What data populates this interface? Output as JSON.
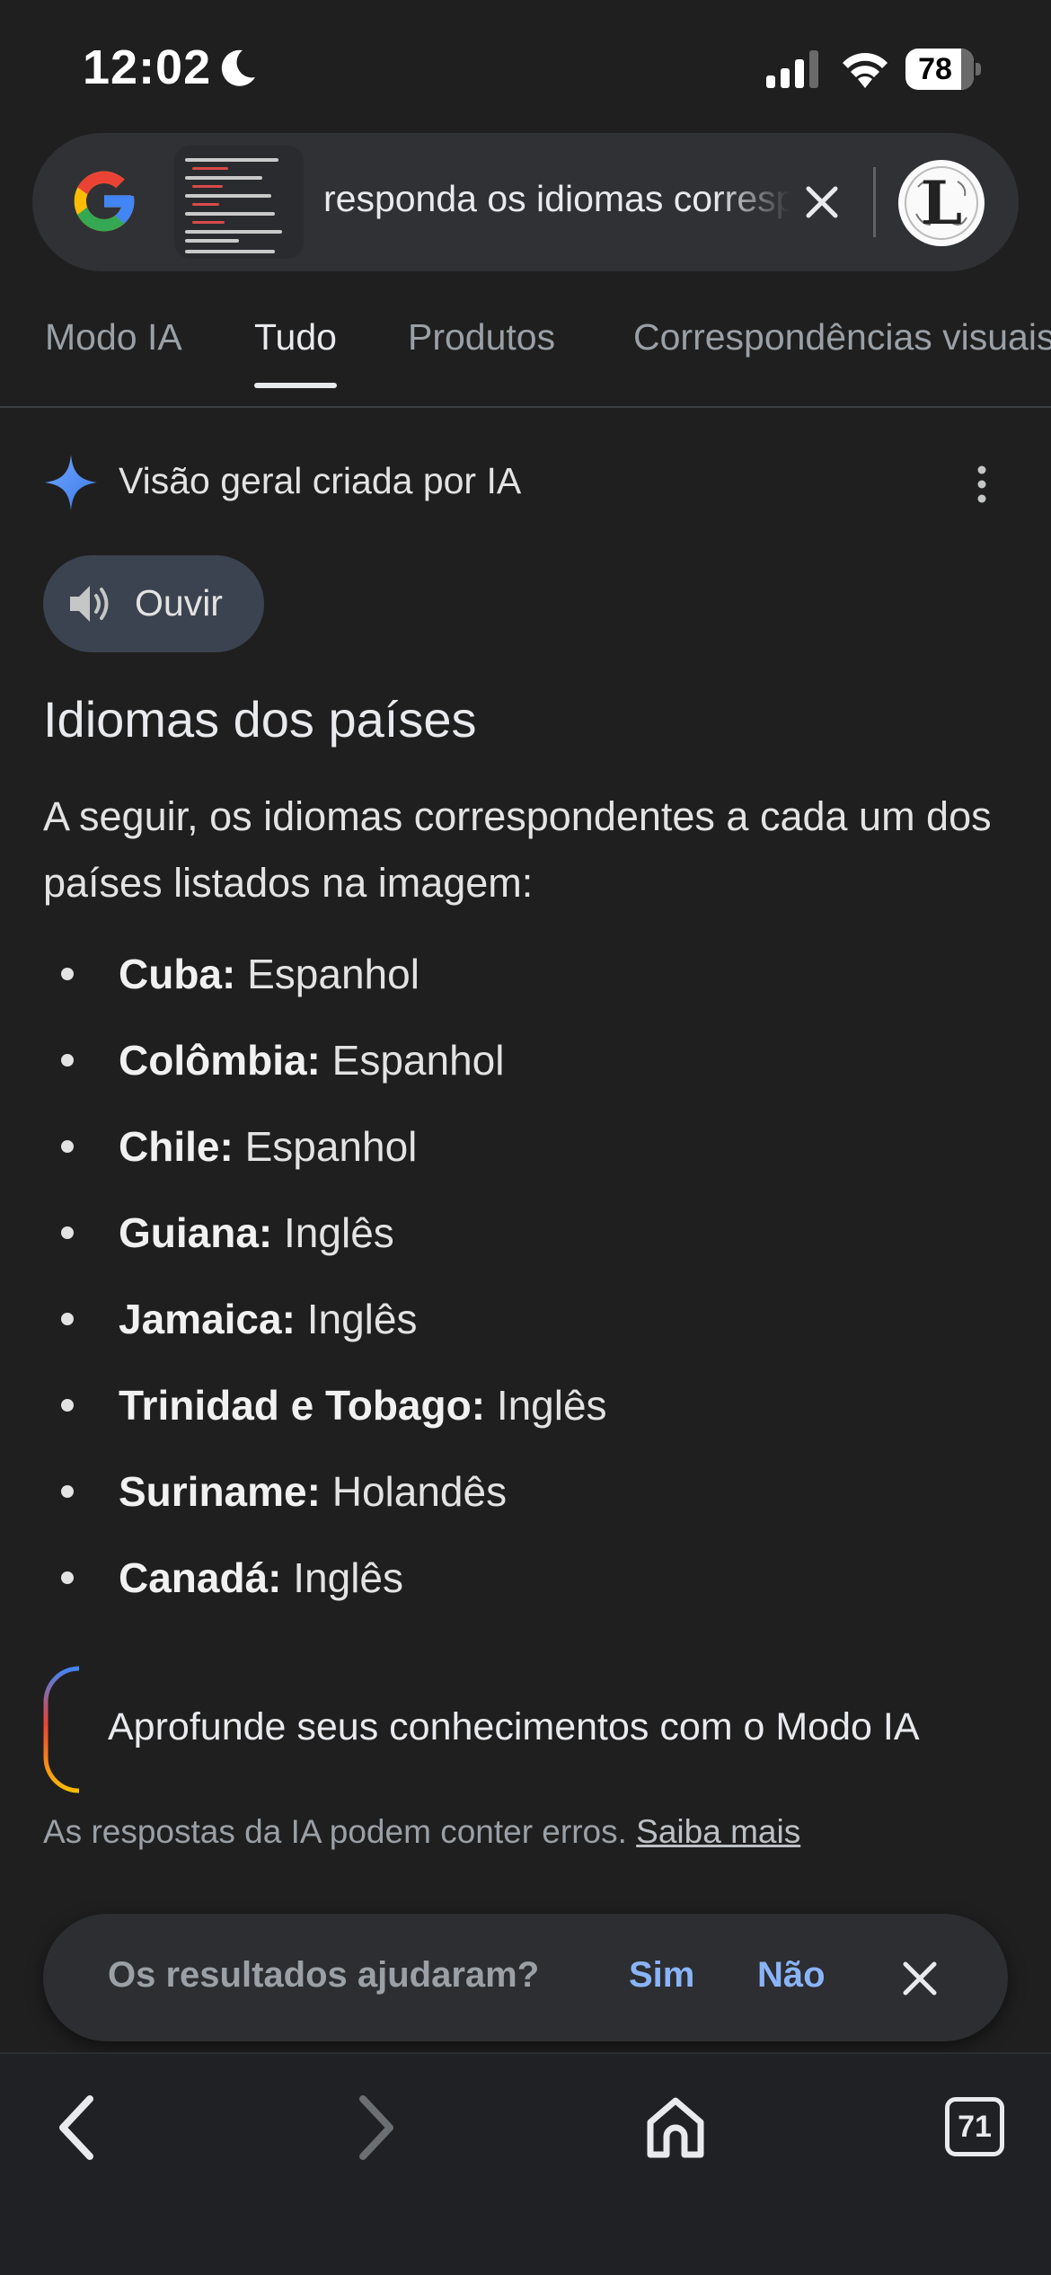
{
  "status_bar": {
    "time": "12:02",
    "battery": "78",
    "icons": [
      "moon-icon",
      "signal-icon",
      "wifi-icon",
      "battery-icon"
    ]
  },
  "search": {
    "query": "responda os idiomas correspondentes",
    "logo": "google-g-icon",
    "thumbnail_lines": [
      "qual é o idioma de colombia",
      "qual é o idioma de chile",
      "qual é o idioma de guiana",
      "qual é o idioma de jamaica",
      "qual é o idioma de trinidad e tobago",
      "qual é o idioma do suriname"
    ],
    "avatar_letter": "L"
  },
  "tabs": [
    {
      "label": "Modo IA",
      "active": false
    },
    {
      "label": "Tudo",
      "active": true
    },
    {
      "label": "Produtos",
      "active": false
    },
    {
      "label": "Correspondências visuais",
      "active": false
    }
  ],
  "ai_overview": {
    "header": "Visão geral criada por IA",
    "listen_label": "Ouvir",
    "title": "Idiomas dos países",
    "intro": "A seguir, os idiomas correspondentes a cada um dos países listados na imagem:",
    "items": [
      {
        "country": "Cuba:",
        "language": "Espanhol"
      },
      {
        "country": "Colômbia:",
        "language": "Espanhol"
      },
      {
        "country": "Chile:",
        "language": "Espanhol"
      },
      {
        "country": "Guiana:",
        "language": "Inglês"
      },
      {
        "country": "Jamaica:",
        "language": "Inglês"
      },
      {
        "country": "Trinidad e Tobago:",
        "language": "Inglês"
      },
      {
        "country": "Suriname:",
        "language": "Holandês"
      },
      {
        "country": "Canadá:",
        "language": "Inglês"
      }
    ],
    "deep_dive_label": "Aprofunde seus conhecimentos com o Modo IA",
    "disclaimer": "As respostas da IA podem conter erros.",
    "learn_more": "Saiba mais"
  },
  "feedback": {
    "question": "Os resultados ajudaram?",
    "yes": "Sim",
    "no": "Não"
  },
  "bottom_nav": {
    "tab_count": "71"
  },
  "colors": {
    "background": "#1f1f1f",
    "accent_blue": "#8ab4f8",
    "google_blue": "#4285f4",
    "google_red": "#ea4335",
    "google_yellow": "#fbbc05",
    "google_green": "#34a853"
  }
}
